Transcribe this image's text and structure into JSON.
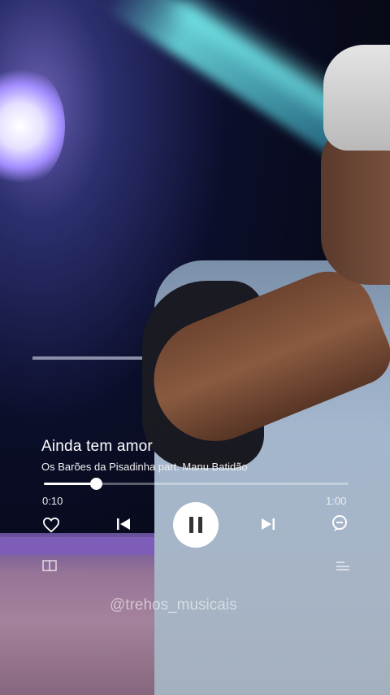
{
  "player": {
    "title": "Ainda tem amor",
    "artist": "Os Barões da Pisadinha part. Manu Batidão",
    "elapsed": "0:10",
    "total": "1:00",
    "progress_fraction": 0.17,
    "state": "playing"
  },
  "icons": {
    "like": "heart-icon",
    "previous": "skip-previous-icon",
    "pause": "pause-icon",
    "next": "skip-next-icon",
    "lyrics": "lyrics-bubble-icon",
    "queue_left": "card-icon",
    "queue_right": "queue-list-icon"
  },
  "watermark": "@trehos_musicais",
  "colors": {
    "text": "#ffffff",
    "pause_button_bg": "#ffffff",
    "track": "rgba(255,255,255,0.35)"
  }
}
